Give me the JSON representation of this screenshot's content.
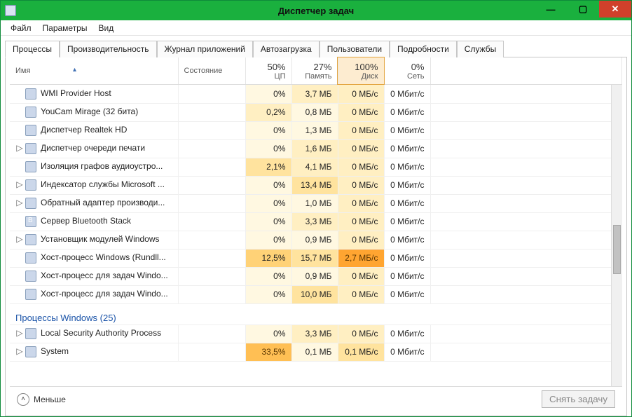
{
  "window": {
    "title": "Диспетчер задач"
  },
  "menu": {
    "file": "Файл",
    "options": "Параметры",
    "view": "Вид"
  },
  "tabs": {
    "processes": "Процессы",
    "performance": "Производительность",
    "app_history": "Журнал приложений",
    "startup": "Автозагрузка",
    "users": "Пользователи",
    "details": "Подробности",
    "services": "Службы"
  },
  "columns": {
    "name": "Имя",
    "status": "Состояние",
    "cpu": {
      "pct": "50%",
      "label": "ЦП"
    },
    "memory": {
      "pct": "27%",
      "label": "Память"
    },
    "disk": {
      "pct": "100%",
      "label": "Диск"
    },
    "network": {
      "pct": "0%",
      "label": "Сеть"
    }
  },
  "group_label": "Процессы Windows (25)",
  "footer": {
    "fewer": "Меньше",
    "end_task": "Снять задачу"
  },
  "rows": [
    {
      "exp": "",
      "icon": "generic",
      "name": "WMI Provider Host",
      "cpu": "0%",
      "cpu_h": 1,
      "mem": "3,7 МБ",
      "mem_h": 2,
      "disk": "0 МБ/с",
      "disk_h": 2,
      "net": "0 Мбит/с"
    },
    {
      "exp": "",
      "icon": "youcam",
      "name": "YouCam Mirage (32 бита)",
      "cpu": "0,2%",
      "cpu_h": 2,
      "mem": "0,8 МБ",
      "mem_h": 1,
      "disk": "0 МБ/с",
      "disk_h": 2,
      "net": "0 Мбит/с"
    },
    {
      "exp": "",
      "icon": "sound",
      "name": "Диспетчер Realtek HD",
      "cpu": "0%",
      "cpu_h": 1,
      "mem": "1,3 МБ",
      "mem_h": 1,
      "disk": "0 МБ/с",
      "disk_h": 2,
      "net": "0 Мбит/с"
    },
    {
      "exp": "▷",
      "icon": "printer",
      "name": "Диспетчер очереди печати",
      "cpu": "0%",
      "cpu_h": 1,
      "mem": "1,6 МБ",
      "mem_h": 2,
      "disk": "0 МБ/с",
      "disk_h": 2,
      "net": "0 Мбит/с"
    },
    {
      "exp": "",
      "icon": "generic",
      "name": "Изоляция графов аудиоустро...",
      "cpu": "2,1%",
      "cpu_h": 3,
      "mem": "4,1 МБ",
      "mem_h": 2,
      "disk": "0 МБ/с",
      "disk_h": 2,
      "net": "0 Мбит/с"
    },
    {
      "exp": "▷",
      "icon": "disk",
      "name": "Индексатор службы Microsoft ...",
      "cpu": "0%",
      "cpu_h": 1,
      "mem": "13,4 МБ",
      "mem_h": 3,
      "disk": "0 МБ/с",
      "disk_h": 2,
      "net": "0 Мбит/с"
    },
    {
      "exp": "▷",
      "icon": "generic",
      "name": "Обратный адаптер производи...",
      "cpu": "0%",
      "cpu_h": 1,
      "mem": "1,0 МБ",
      "mem_h": 1,
      "disk": "0 МБ/с",
      "disk_h": 2,
      "net": "0 Мбит/с"
    },
    {
      "exp": "",
      "icon": "bt",
      "name": "Сервер Bluetooth Stack",
      "cpu": "0%",
      "cpu_h": 1,
      "mem": "3,3 МБ",
      "mem_h": 2,
      "disk": "0 МБ/с",
      "disk_h": 2,
      "net": "0 Мбит/с"
    },
    {
      "exp": "▷",
      "icon": "generic",
      "name": "Установщик модулей Windows",
      "cpu": "0%",
      "cpu_h": 1,
      "mem": "0,9 МБ",
      "mem_h": 1,
      "disk": "0 МБ/с",
      "disk_h": 2,
      "net": "0 Мбит/с"
    },
    {
      "exp": "",
      "icon": "doc",
      "name": "Хост-процесс Windows (Rundll...",
      "cpu": "12,5%",
      "cpu_h": 4,
      "mem": "15,7 МБ",
      "mem_h": 3,
      "disk": "2,7 МБ/с",
      "disk_h": 6,
      "net": "0 Мбит/с"
    },
    {
      "exp": "",
      "icon": "generic",
      "name": "Хост-процесс для задач Windo...",
      "cpu": "0%",
      "cpu_h": 1,
      "mem": "0,9 МБ",
      "mem_h": 1,
      "disk": "0 МБ/с",
      "disk_h": 2,
      "net": "0 Мбит/с"
    },
    {
      "exp": "",
      "icon": "generic",
      "name": "Хост-процесс для задач Windo...",
      "cpu": "0%",
      "cpu_h": 1,
      "mem": "10,0 МБ",
      "mem_h": 3,
      "disk": "0 МБ/с",
      "disk_h": 2,
      "net": "0 Мбит/с"
    }
  ],
  "rows2": [
    {
      "exp": "▷",
      "icon": "generic",
      "name": "Local Security Authority Process",
      "cpu": "0%",
      "cpu_h": 1,
      "mem": "3,3 МБ",
      "mem_h": 2,
      "disk": "0 МБ/с",
      "disk_h": 2,
      "net": "0 Мбит/с"
    },
    {
      "exp": "▷",
      "icon": "generic",
      "name": "System",
      "cpu": "33,5%",
      "cpu_h": 5,
      "mem": "0,1 МБ",
      "mem_h": 1,
      "disk": "0,1 МБ/с",
      "disk_h": 3,
      "net": "0 Мбит/с"
    }
  ]
}
